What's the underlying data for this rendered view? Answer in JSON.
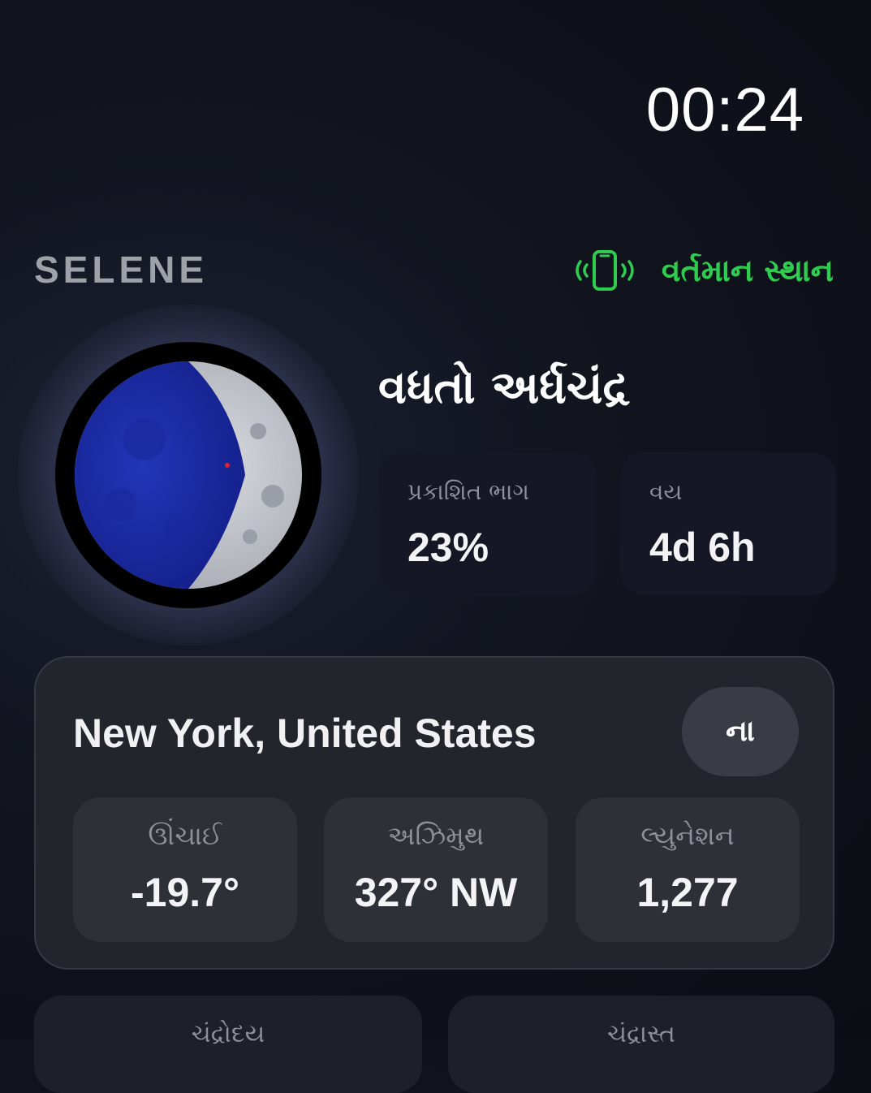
{
  "status": {
    "time": "00:24"
  },
  "header": {
    "brand": "SELENE",
    "location_link": {
      "icon": "phone-signal-icon",
      "label": "વર્તમાન સ્થાન",
      "color": "#2ecc4f"
    }
  },
  "moon": {
    "phase_name": "વધતો અર્ધચંદ્ર",
    "illumination_fraction": 0.23,
    "stats": [
      {
        "label": "પ્રકાશિત ભાગ",
        "value": "23%"
      },
      {
        "label": "વય",
        "value": "4d 6h"
      }
    ]
  },
  "location_panel": {
    "title": "New York, United States",
    "toggle_label": "ના",
    "metrics": [
      {
        "label": "ઊંચાઈ",
        "value": "-19.7°"
      },
      {
        "label": "અઝિમુથ",
        "value": "327° NW"
      },
      {
        "label": "લ્યુનેશન",
        "value": "1,277"
      }
    ]
  },
  "bottom_cards": [
    {
      "label": "ચંદ્રોદય"
    },
    {
      "label": "ચંદ્રાસ્ત"
    }
  ]
}
